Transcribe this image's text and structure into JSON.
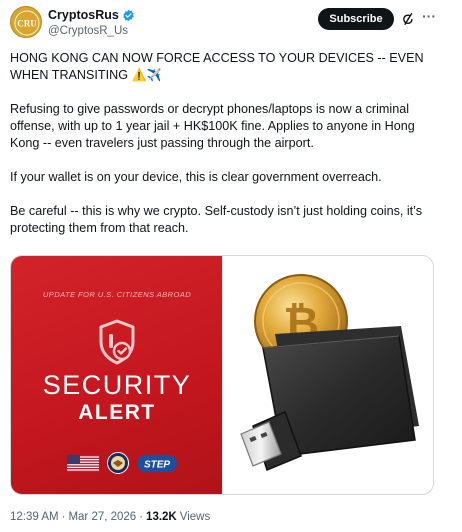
{
  "header": {
    "account_name": "CryptosRus",
    "handle": "@CryptosR_Us",
    "avatar_text": "CRU",
    "subscribe_label": "Subscribe",
    "verified_color": "#1d9bf0"
  },
  "post": {
    "headline": "HONG KONG CAN NOW FORCE ACCESS TO YOUR DEVICES -- EVEN WHEN TRANSITING",
    "headline_emoji": "⚠️✈️",
    "paragraph_1": "Refusing to give passwords or decrypt phones/laptops is now a criminal offense, with up to 1 year jail + HK$100K fine. Applies to anyone in Hong Kong -- even travelers just passing through the airport.",
    "paragraph_2": "If your wallet is on your device, this is clear government overreach.",
    "paragraph_3": "Be careful -- this is why we crypto. Self-custody isn’t just holding coins, it’s protecting them from that reach."
  },
  "media": {
    "update_text": "UPDATE FOR U.S. CITIZENS ABROAD",
    "security_text": "SECURITY",
    "alert_text": "ALERT",
    "step_label": "STEP",
    "alert_bg_color": "#c8181f"
  },
  "footer": {
    "time": "12:39 AM",
    "separator": "·",
    "date": "Mar 27, 2026",
    "separator2": "·",
    "views_count": "13.2K",
    "views_label": "Views"
  },
  "icons": {
    "verified": "verified-badge-icon",
    "grok": "grok-icon",
    "more": "more-options-icon"
  }
}
